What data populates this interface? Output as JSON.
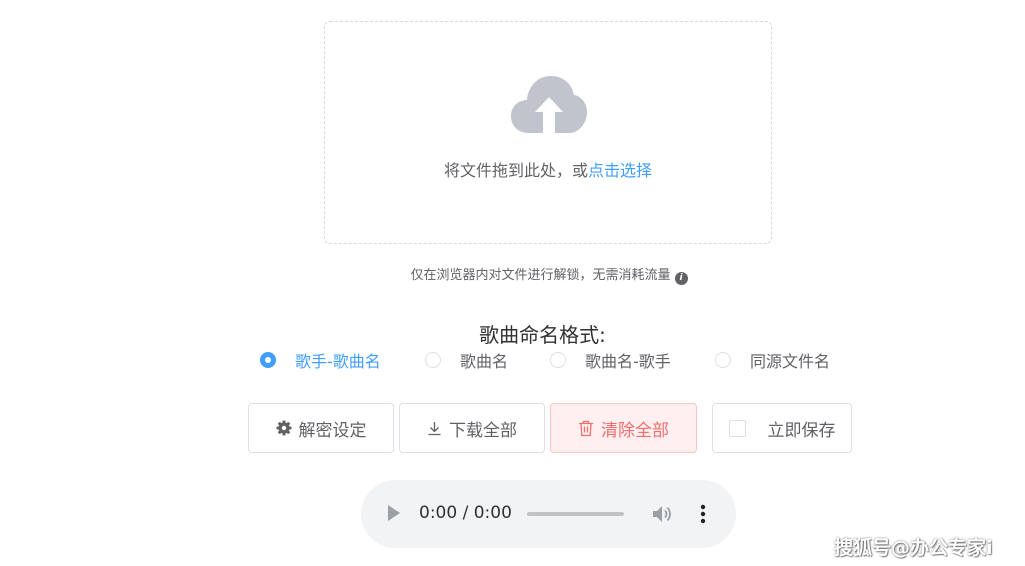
{
  "upload": {
    "text": "将文件拖到此处，或",
    "link": "点击选择"
  },
  "tip": {
    "text": "仅在浏览器内对文件进行解锁，无需消耗流量",
    "info_icon": "i"
  },
  "format": {
    "title": "歌曲命名格式:",
    "options": [
      {
        "label": "歌手-歌曲名",
        "checked": true
      },
      {
        "label": "歌曲名",
        "checked": false
      },
      {
        "label": "歌曲名-歌手",
        "checked": false
      },
      {
        "label": "同源文件名",
        "checked": false
      }
    ]
  },
  "buttons": {
    "settings": "解密设定",
    "download_all": "下载全部",
    "clear_all": "清除全部",
    "save_now": "立即保存"
  },
  "audio": {
    "time": "0:00 / 0:00"
  },
  "watermark": "搜狐号@办公专家i",
  "colors": {
    "accent": "#409eff",
    "danger": "#f56c6c",
    "danger_bg": "#fef0f0"
  }
}
